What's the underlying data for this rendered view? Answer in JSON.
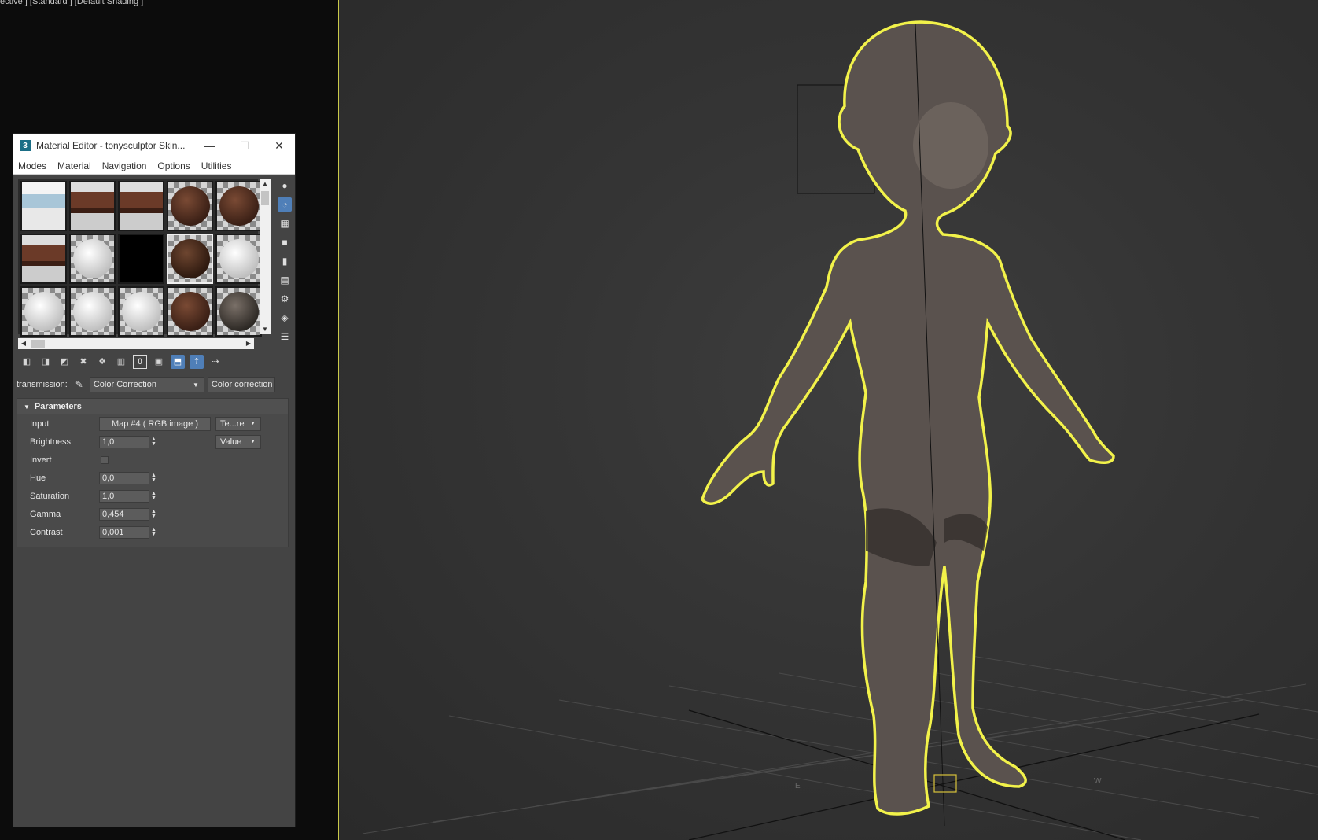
{
  "viewport": {
    "label": "ective ] [Standard ] [Default Shading ]",
    "compass": {
      "east": "E",
      "west": "W"
    }
  },
  "window": {
    "app_icon": "3",
    "title": "Material Editor - tonysculptor Skin...",
    "minimize": "—",
    "maximize": "☐",
    "close": "✕"
  },
  "menu": [
    "Modes",
    "Material",
    "Navigation",
    "Options",
    "Utilities"
  ],
  "slots": [
    {
      "kind": "scene"
    },
    {
      "kind": "teeth"
    },
    {
      "kind": "teeth"
    },
    {
      "kind": "skin"
    },
    {
      "kind": "skin"
    },
    {
      "kind": "teeth"
    },
    {
      "kind": "white"
    },
    {
      "kind": "black"
    },
    {
      "kind": "skin-active"
    },
    {
      "kind": "white"
    },
    {
      "kind": "white"
    },
    {
      "kind": "white"
    },
    {
      "kind": "white"
    },
    {
      "kind": "skin"
    },
    {
      "kind": "noise"
    }
  ],
  "side_tools": [
    "sphere-icon",
    "backlight-icon",
    "background-icon",
    "sample-uv-icon",
    "video-check-icon",
    "preview-icon",
    "options-icon",
    "select-by-material-icon",
    "material-navigator-icon"
  ],
  "toolbar_tools": [
    "get-material-icon",
    "put-to-scene-icon",
    "assign-icon",
    "reset-icon",
    "make-unique-icon",
    "put-to-library-icon",
    "material-id-icon",
    "show-map-icon",
    "show-end-result-icon",
    "go-to-parent-icon",
    "go-forward-sibling-icon"
  ],
  "material_id_label": "0",
  "map": {
    "label": "transmission:",
    "type": "Color Correction",
    "name": "Color correction"
  },
  "parameters": {
    "title": "Parameters",
    "input_label": "Input",
    "input_map": "Map #4  ( RGB image )",
    "input_mode": "Te...re",
    "brightness_label": "Brightness",
    "brightness": "1,0",
    "brightness_mode": "Value",
    "invert_label": "Invert",
    "hue_label": "Hue",
    "hue": "0,0",
    "saturation_label": "Saturation",
    "saturation": "1,0",
    "gamma_label": "Gamma",
    "gamma": "0,454",
    "contrast_label": "Contrast",
    "contrast": "0,001"
  }
}
